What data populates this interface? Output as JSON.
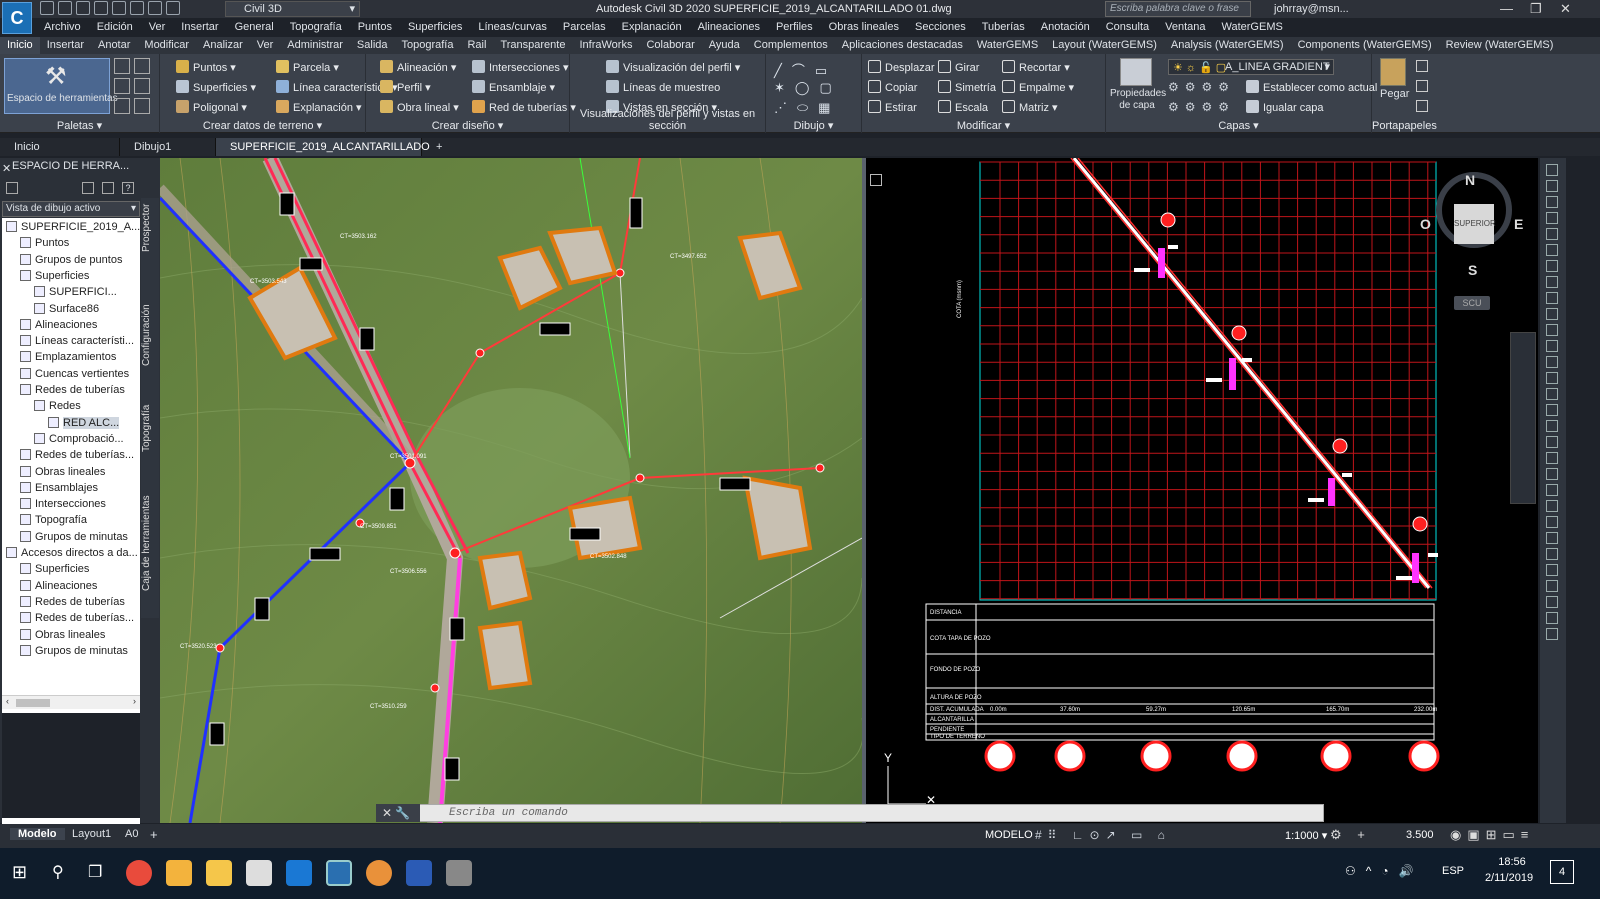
{
  "titlebar": {
    "logo": "C",
    "workspace": "Civil 3D",
    "app_title": "Autodesk Civil 3D 2020    SUPERFICIE_2019_ALCANTARILLADO 01.dwg",
    "search_placeholder": "Escriba palabra clave o frase",
    "user": "johrray@msn...",
    "minimize": "—",
    "restore": "❐",
    "close": "✕"
  },
  "menu": [
    "Archivo",
    "Edición",
    "Ver",
    "Insertar",
    "General",
    "Topografía",
    "Puntos",
    "Superficies",
    "Líneas/curvas",
    "Parcelas",
    "Explanación",
    "Alineaciones",
    "Perfiles",
    "Obras lineales",
    "Secciones",
    "Tuberías",
    "Anotación",
    "Consulta",
    "Ventana",
    "WaterGEMS"
  ],
  "ribbon_tabs": [
    "Inicio",
    "Insertar",
    "Anotar",
    "Modificar",
    "Analizar",
    "Ver",
    "Administrar",
    "Salida",
    "Topografía",
    "Rail",
    "Transparente",
    "InfraWorks",
    "Colaborar",
    "Ayuda",
    "Complementos",
    "Aplicaciones destacadas",
    "WaterGEMS",
    "Layout (WaterGEMS)",
    "Analysis (WaterGEMS)",
    "Components (WaterGEMS)",
    "Review (WaterGEMS)"
  ],
  "ribbon": {
    "palettes": {
      "big_label": "Espacio de herramientas",
      "title": "Paletas ▾"
    },
    "terrain": {
      "title": "Crear datos de terreno ▾",
      "b1": "Puntos ▾",
      "b2": "Superficies ▾",
      "b3": "Poligonal ▾",
      "b4": "Parcela ▾",
      "b5": "Línea característica ▾",
      "b6": "Explanación ▾"
    },
    "design": {
      "title": "Crear diseño ▾",
      "b1": "Alineación ▾",
      "b2": "Perfil ▾",
      "b3": "Obra lineal ▾",
      "b4": "Intersecciones ▾",
      "b5": "Ensamblaje ▾",
      "b6": "Red de tuberías ▾"
    },
    "profile": {
      "title": "Visualizaciones del perfil y vistas en sección",
      "b1": "Visualización del perfil ▾",
      "b2": "Líneas de muestreo",
      "b3": "Vistas en sección ▾"
    },
    "draw": {
      "title": "Dibujo ▾"
    },
    "modify": {
      "title": "Modificar ▾",
      "b1": "Desplazar",
      "b2": "Copiar",
      "b3": "Estirar",
      "b4": "Girar",
      "b5": "Simetría",
      "b6": "Escala",
      "b7": "Recortar ▾",
      "b8": "Empalme ▾",
      "b9": "Matriz ▾"
    },
    "layers": {
      "title": "Capas ▾",
      "big_label": "Propiedades de capa",
      "layer_name": "A_LINEA GRADIENT",
      "b1": "Establecer como actual",
      "b2": "Igualar capa"
    },
    "clipboard": {
      "title": "Portapapeles",
      "big_label": "Pegar"
    }
  },
  "doc_tabs": [
    "Inicio",
    "Dibujo1",
    "SUPERFICIE_2019_ALCANTARILLADO 01*"
  ],
  "palette": {
    "title": "ESPACIO DE HERRA...",
    "view_select": "Vista de dibujo activo",
    "side_tabs": [
      "Prospector",
      "Configuración",
      "Topografía",
      "Caja de herramientas"
    ],
    "tree": [
      {
        "label": "SUPERFICIE_2019_A...",
        "level": 0
      },
      {
        "label": "Puntos",
        "level": 1
      },
      {
        "label": "Grupos de puntos",
        "level": 1
      },
      {
        "label": "Superficies",
        "level": 1
      },
      {
        "label": "SUPERFICI...",
        "level": 2
      },
      {
        "label": "Surface86",
        "level": 2
      },
      {
        "label": "Alineaciones",
        "level": 1
      },
      {
        "label": "Líneas característi...",
        "level": 1
      },
      {
        "label": "Emplazamientos",
        "level": 1
      },
      {
        "label": "Cuencas vertientes",
        "level": 1
      },
      {
        "label": "Redes de tuberías",
        "level": 1
      },
      {
        "label": "Redes",
        "level": 2
      },
      {
        "label": "RED ALC...",
        "level": 3
      },
      {
        "label": "Comprobació...",
        "level": 2
      },
      {
        "label": "Redes de tuberías...",
        "level": 1
      },
      {
        "label": "Obras lineales",
        "level": 1
      },
      {
        "label": "Ensamblajes",
        "level": 1
      },
      {
        "label": "Intersecciones",
        "level": 1
      },
      {
        "label": "Topografía",
        "level": 1
      },
      {
        "label": "Grupos de minutas",
        "level": 1
      },
      {
        "label": "Accesos directos a da...",
        "level": 0
      },
      {
        "label": "Superficies",
        "level": 1
      },
      {
        "label": "Alineaciones",
        "level": 1
      },
      {
        "label": "Redes de tuberías",
        "level": 1
      },
      {
        "label": "Redes de tuberías...",
        "level": 1
      },
      {
        "label": "Obras lineales",
        "level": 1
      },
      {
        "label": "Grupos de minutas",
        "level": 1
      }
    ]
  },
  "viewport_right": {
    "compass": {
      "n": "N",
      "s": "S",
      "e": "E",
      "w": "O",
      "center": "SUPERIOR",
      "wcs": "SCU"
    },
    "axis_y": "Y",
    "axis_label": "COTA (msnm)",
    "table_rows": [
      "DISTANCIA",
      "COTA TAPA DE POZO",
      "FONDO DE POZO",
      "ALTURA DE POZO",
      "DIST. ACUMULADA",
      "ALCANTARILLA",
      "PENDIENTE",
      "TIPO DE TERRENO"
    ],
    "accum": [
      "0.00m",
      "37.60m",
      "59.27m",
      "120.65m",
      "165.70m",
      "232.00m"
    ]
  },
  "command": {
    "placeholder": "Escriba un comando"
  },
  "status": {
    "tabs": [
      "Modelo",
      "Layout1",
      "A0"
    ],
    "mode": "MODELO",
    "scale": "1:1000 ▾",
    "value": "3.500"
  },
  "taskbar": {
    "lang": "ESP",
    "time": "18:56",
    "date": "2/11/2019",
    "notif": "4"
  }
}
